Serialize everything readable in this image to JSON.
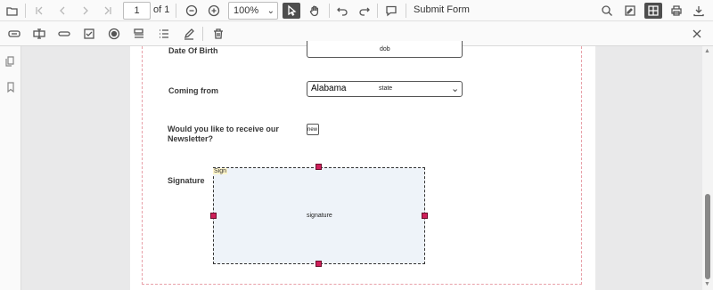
{
  "toolbar": {
    "page_number": "1",
    "page_of": "of 1",
    "zoom": "100%",
    "submit_label": "Submit Form"
  },
  "form": {
    "dob_label": "Date Of Birth",
    "dob_placeholder": "dob",
    "coming_from_label": "Coming from",
    "state_value": "Alabama",
    "state_name": "state",
    "newsletter_label_1": "Would you like to receive our",
    "newsletter_label_2": "Newsletter?",
    "newsletter_name": "new",
    "signature_label": "Signature",
    "signature_name": "signature",
    "sign_tag": "Sign"
  },
  "colors": {
    "accent": "#cf1f5a",
    "active_tool": "#4e4e4e",
    "page_border": "#e8a0a8",
    "signature_fill": "#eef3f9"
  }
}
